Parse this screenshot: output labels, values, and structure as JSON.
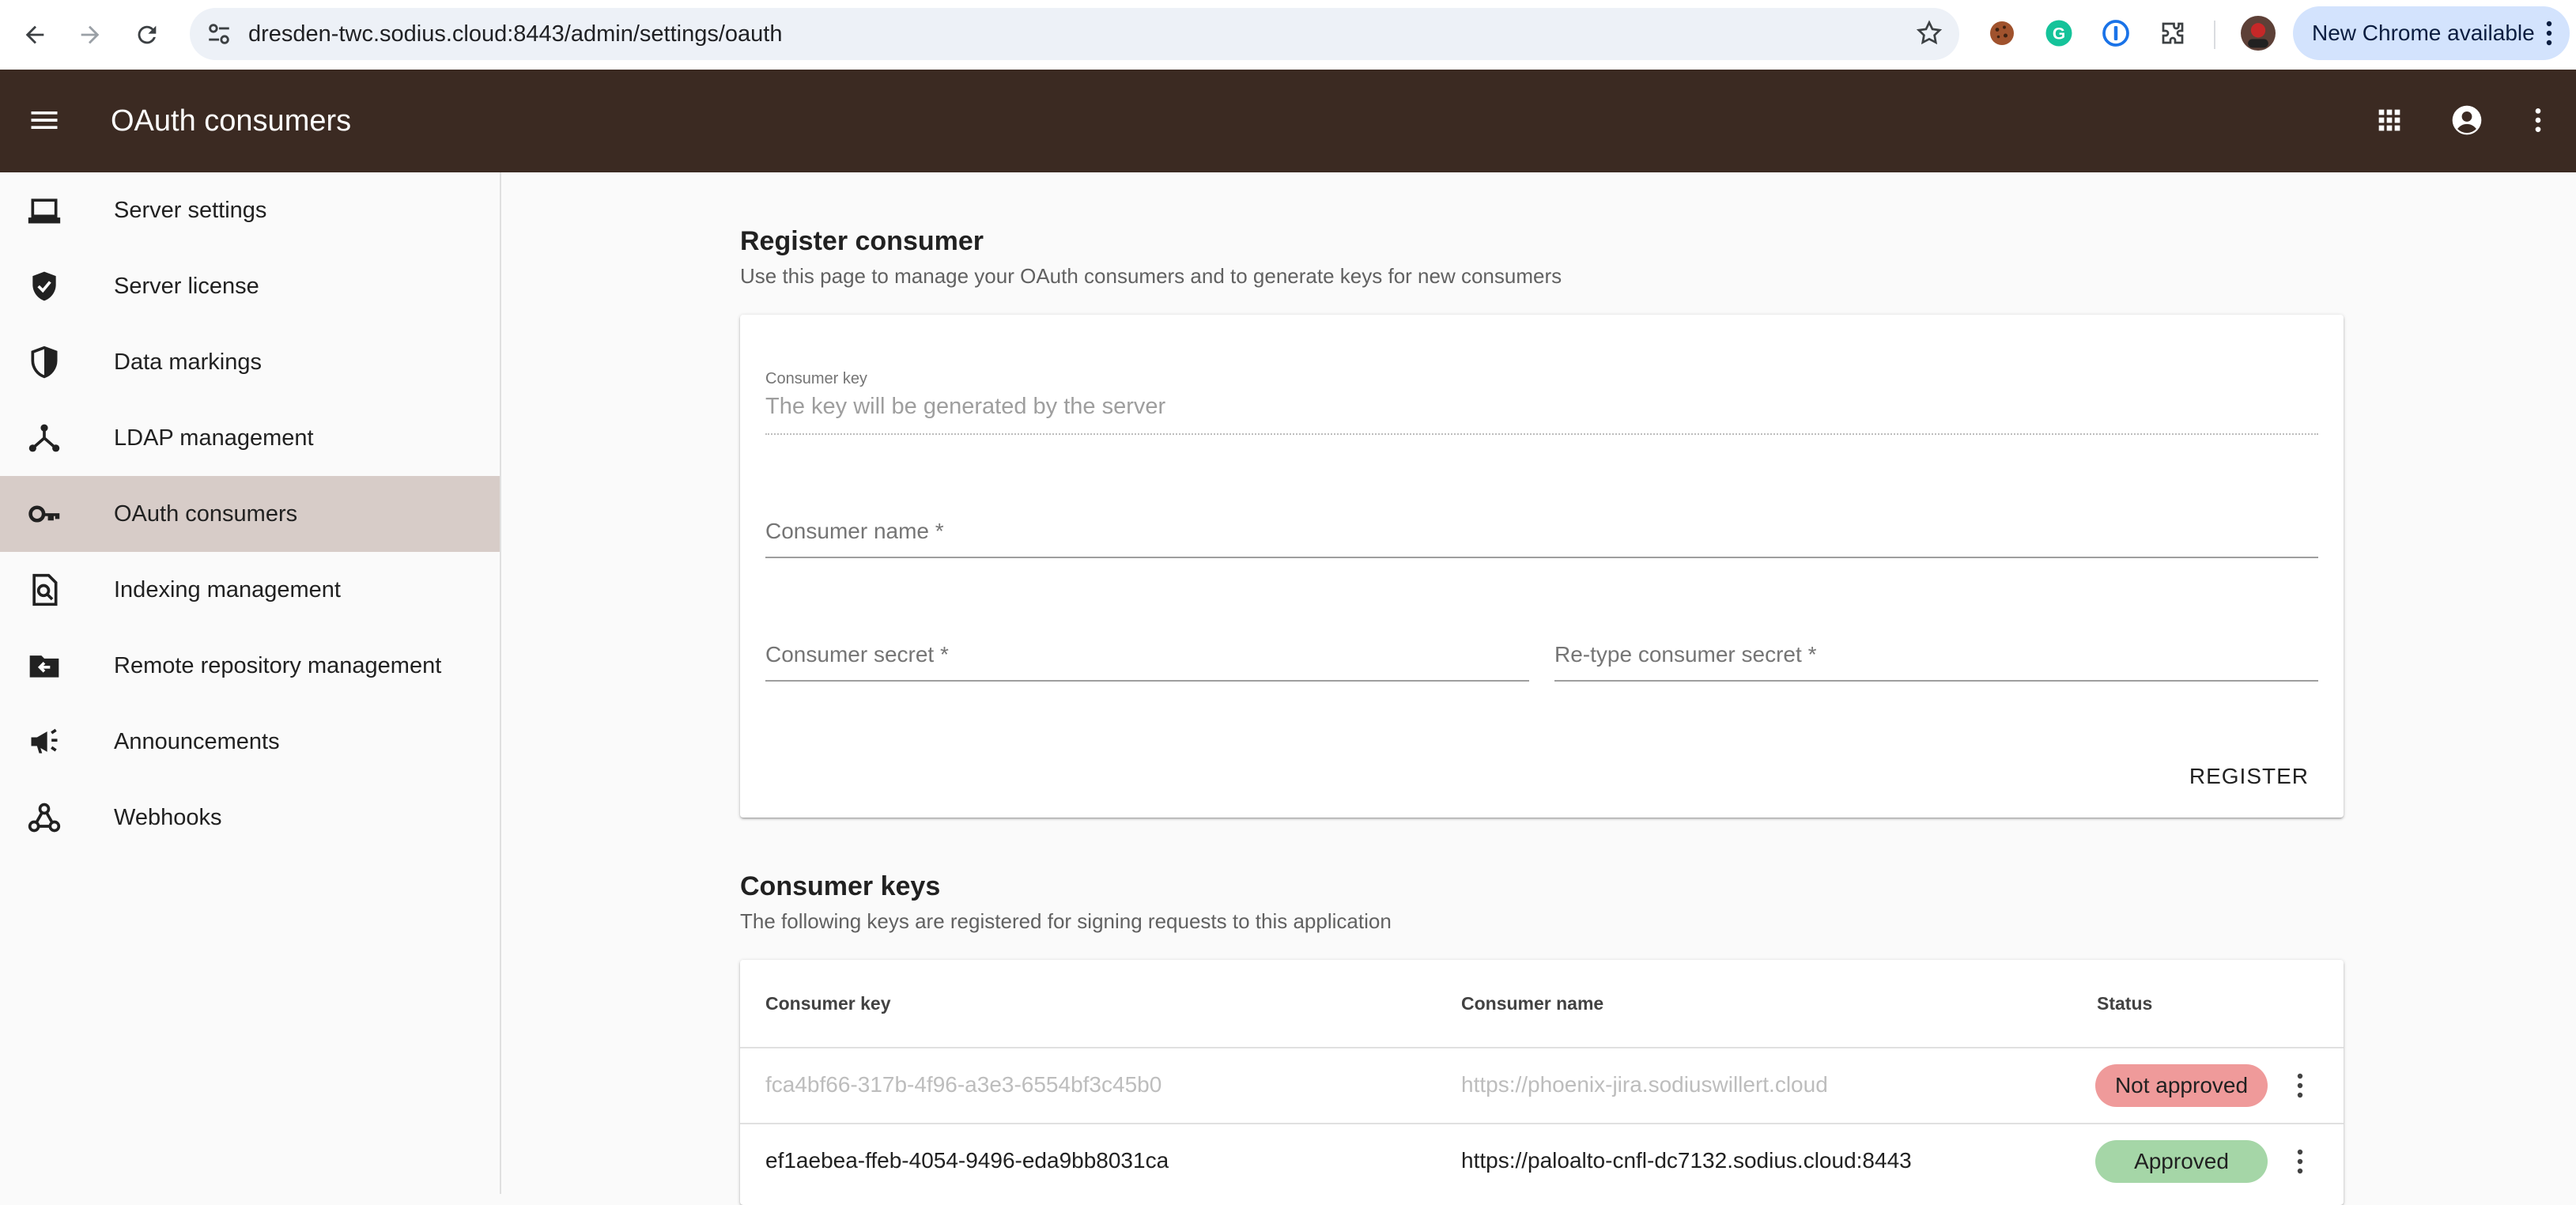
{
  "browser": {
    "url": "dresden-twc.sodius.cloud:8443/admin/settings/oauth",
    "update_label": "New Chrome available"
  },
  "appbar": {
    "title": "OAuth consumers"
  },
  "sidebar": {
    "items": [
      {
        "label": "Server settings",
        "icon": "laptop-icon"
      },
      {
        "label": "Server license",
        "icon": "verified-shield-icon"
      },
      {
        "label": "Data markings",
        "icon": "half-shield-icon"
      },
      {
        "label": "LDAP management",
        "icon": "hub-icon"
      },
      {
        "label": "OAuth consumers",
        "icon": "key-icon"
      },
      {
        "label": "Indexing management",
        "icon": "find-in-page-icon"
      },
      {
        "label": "Remote repository management",
        "icon": "drive-folder-icon"
      },
      {
        "label": "Announcements",
        "icon": "campaign-icon"
      },
      {
        "label": "Webhooks",
        "icon": "webhook-icon"
      }
    ],
    "active_index": 4
  },
  "register": {
    "title": "Register consumer",
    "subtitle": "Use this page to manage your OAuth consumers and to generate keys for new consumers",
    "consumer_key_label": "Consumer key",
    "consumer_key_value": "The key will be generated by the server",
    "consumer_name_placeholder": "Consumer name *",
    "consumer_secret_placeholder": "Consumer secret *",
    "retype_secret_placeholder": "Re-type consumer secret *",
    "register_label": "REGISTER"
  },
  "keys": {
    "title": "Consumer keys",
    "subtitle": "The following keys are registered for signing requests to this application",
    "columns": [
      "Consumer key",
      "Consumer name",
      "Status"
    ],
    "rows": [
      {
        "key": "fca4bf66-317b-4f96-a3e3-6554bf3c45b0",
        "name": "https://phoenix-jira.sodiuswillert.cloud",
        "status": "Not approved",
        "approved": false
      },
      {
        "key": "ef1aebea-ffeb-4054-9496-eda9bb8031ca",
        "name": "https://paloalto-cnfl-dc7132.sodius.cloud:8443",
        "status": "Approved",
        "approved": true
      }
    ]
  },
  "colors": {
    "appbar": "#3b2a22",
    "active_item": "#d7ccc8",
    "not_approved": "#ef9a9a",
    "approved": "#a5d6a7",
    "update_pill": "#d3e3fd"
  }
}
